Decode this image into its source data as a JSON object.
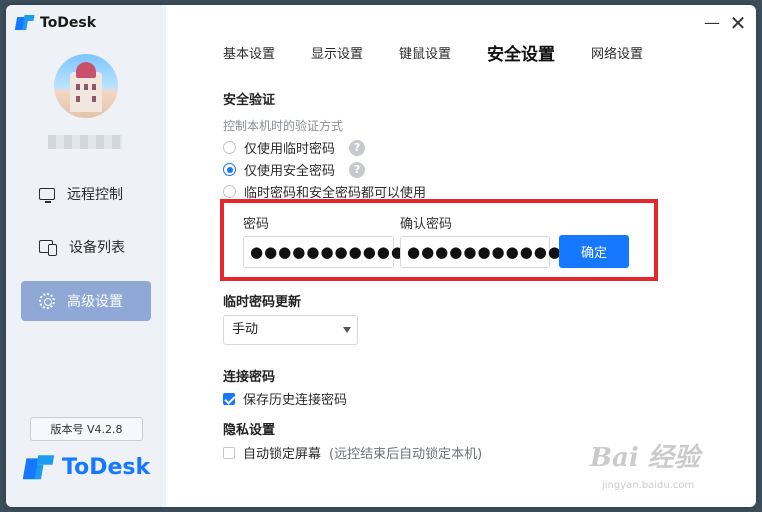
{
  "app": {
    "title": "ToDesk",
    "brand": "ToDesk",
    "version_label": "版本号 V4.2.8"
  },
  "sidebar": {
    "items": [
      {
        "label": "远程控制",
        "icon": "monitor-icon"
      },
      {
        "label": "设备列表",
        "icon": "devices-icon"
      },
      {
        "label": "高级设置",
        "icon": "gear-icon",
        "active": true
      }
    ]
  },
  "tabs": [
    {
      "label": "基本设置"
    },
    {
      "label": "显示设置"
    },
    {
      "label": "键鼠设置"
    },
    {
      "label": "安全设置",
      "active": true
    },
    {
      "label": "网络设置"
    }
  ],
  "security": {
    "title": "安全验证",
    "subtitle": "控制本机时的验证方式",
    "options": [
      {
        "label": "仅使用临时密码",
        "selected": false
      },
      {
        "label": "仅使用安全密码",
        "selected": true
      },
      {
        "label": "临时密码和安全密码都可以使用",
        "selected": false
      }
    ],
    "password_label": "密码",
    "password_value": "●●●●●●●●●●●●●●",
    "confirm_label": "确认密码",
    "confirm_value": "●●●●●●●●●●●●●●",
    "confirm_button": "确定"
  },
  "temp_password": {
    "title": "临时密码更新",
    "selected": "手动"
  },
  "connection_password": {
    "title": "连接密码",
    "save_history_label": "保存历史连接密码",
    "save_history_checked": true
  },
  "privacy": {
    "title": "隐私设置",
    "auto_lock_label": "自动锁定屏幕",
    "auto_lock_hint": "(远控结束后自动锁定本机)",
    "auto_lock_checked": false
  },
  "watermark": {
    "text": "Bai 经验",
    "sub": "jingyan.baidu.com"
  },
  "colors": {
    "accent": "#1677ff",
    "highlight": "#e8262d",
    "sidebar_active": "#8fa8d6"
  }
}
